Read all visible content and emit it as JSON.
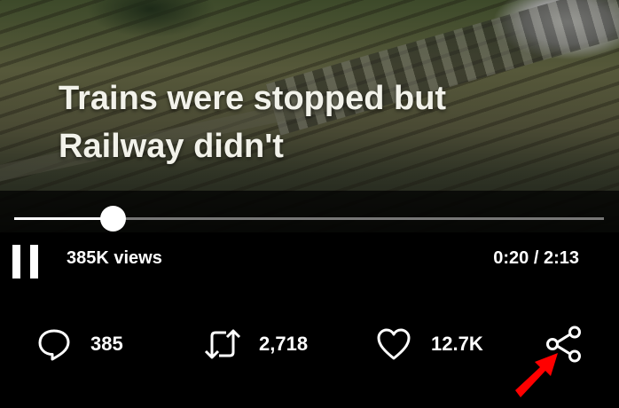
{
  "video": {
    "caption_line1": "Trains were stopped but",
    "caption_line2": "Railway didn't"
  },
  "player": {
    "progress_fraction": 0.167,
    "views": "385K views",
    "time": "0:20 / 2:13"
  },
  "actions": {
    "replies": "385",
    "reposts": "2,718",
    "likes": "12.7K"
  },
  "colors": {
    "background": "#000000",
    "text": "#ffffff",
    "annotation_arrow": "#ff0000"
  },
  "icons": [
    "pause-icon",
    "reply-icon",
    "repost-icon",
    "like-icon",
    "share-icon",
    "pointer-arrow-icon"
  ]
}
